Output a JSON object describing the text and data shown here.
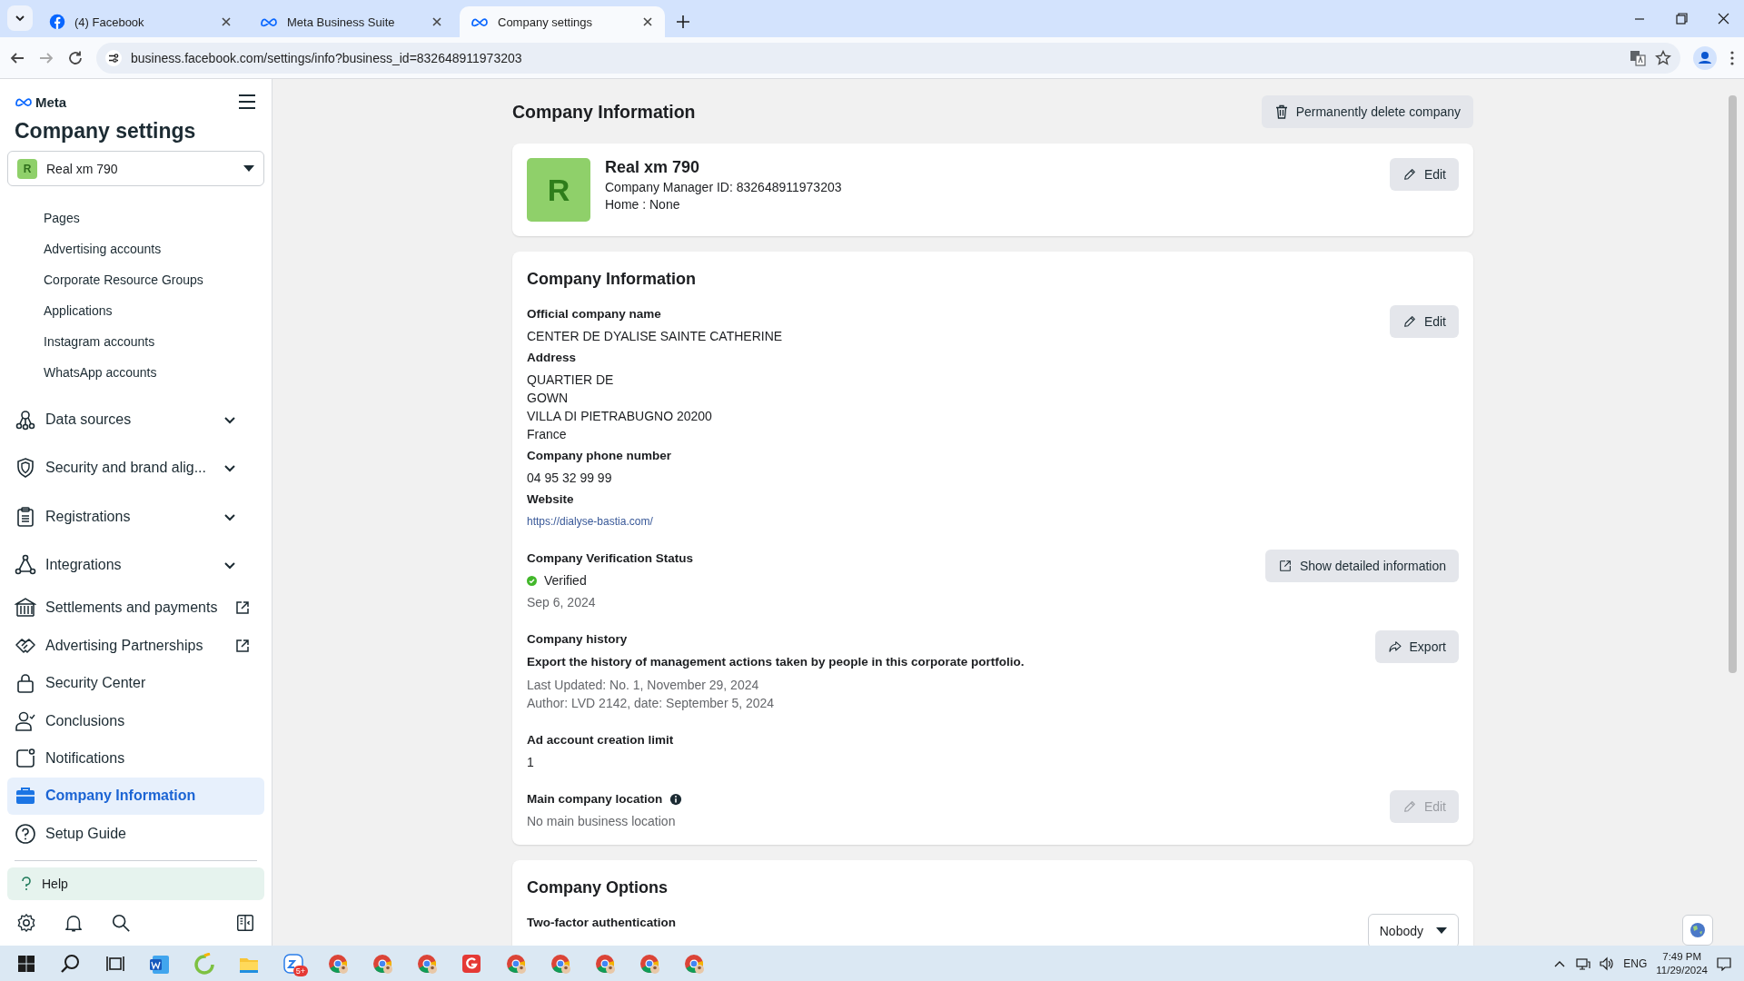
{
  "browser": {
    "tabs": [
      {
        "title": "(4) Facebook",
        "selected": false
      },
      {
        "title": "Meta Business Suite",
        "selected": false
      },
      {
        "title": "Company settings",
        "selected": true
      }
    ],
    "url": "business.facebook.com/settings/info?business_id=832648911973203"
  },
  "sidebar": {
    "brand": "Meta",
    "title": "Company settings",
    "account": {
      "initial": "R",
      "name": "Real xm 790"
    },
    "sub_items": [
      "Pages",
      "Advertising accounts",
      "Corporate Resource Groups",
      "Applications",
      "Instagram accounts",
      "WhatsApp accounts"
    ],
    "items": [
      {
        "label": "Data sources",
        "kind": "expandable",
        "selected": false
      },
      {
        "label": "Security and brand alig...",
        "kind": "expandable",
        "selected": false
      },
      {
        "label": "Registrations",
        "kind": "expandable",
        "selected": false
      },
      {
        "label": "Integrations",
        "kind": "expandable",
        "selected": false
      },
      {
        "label": "Settlements and payments",
        "kind": "external",
        "selected": false
      },
      {
        "label": "Advertising Partnerships",
        "kind": "external",
        "selected": false
      },
      {
        "label": "Security Center",
        "kind": "plain",
        "selected": false
      },
      {
        "label": "Conclusions",
        "kind": "plain",
        "selected": false
      },
      {
        "label": "Notifications",
        "kind": "plain",
        "selected": false
      },
      {
        "label": "Company Information",
        "kind": "plain",
        "selected": true
      },
      {
        "label": "Setup Guide",
        "kind": "plain",
        "selected": false
      }
    ],
    "help": "Help"
  },
  "main": {
    "heading": "Company Information",
    "delete_button": "Permanently delete company",
    "profile": {
      "initial": "R",
      "name": "Real xm 790",
      "manager_id": "Company Manager ID: 832648911973203",
      "home": "Home : None",
      "button": {
        "label": "Edit",
        "kind": "edit",
        "disabled": false
      }
    },
    "info_card": {
      "title": "Company Information",
      "groups": [
        {
          "button": {
            "label": "Edit",
            "kind": "edit",
            "disabled": false
          },
          "fields": [
            {
              "kind": "text",
              "label": "Official company name",
              "lines": [
                "CENTER DE DYALISE SAINTE CATHERINE"
              ]
            },
            {
              "kind": "text",
              "label": "Address",
              "lines": [
                "QUARTIER DE",
                "GOWN",
                "VILLA DI PIETRABUGNO 20200",
                "France"
              ]
            },
            {
              "kind": "text",
              "label": "Company phone number",
              "lines": [
                "04 95 32 99 99"
              ]
            },
            {
              "kind": "link",
              "label": "Website",
              "lines": [
                "https://dialyse-bastia.com/"
              ]
            }
          ]
        },
        {
          "button": {
            "label": "Show detailed information",
            "kind": "details",
            "disabled": false
          },
          "fields": [
            {
              "kind": "status",
              "label": "Company Verification Status",
              "status": "Verified",
              "verified": true,
              "lines": [
                "Sep 6, 2024"
              ]
            }
          ]
        },
        {
          "button": {
            "label": "Export",
            "kind": "export",
            "disabled": false
          },
          "fields": [
            {
              "kind": "history",
              "label": "Company history",
              "description": "Export the history of management actions taken by people in this corporate portfolio.",
              "lines": [
                "Last Updated: No. 1, November 29, 2024",
                "Author: LVD 2142, date: September 5, 2024"
              ]
            }
          ]
        },
        {
          "fields": [
            {
              "kind": "text",
              "label": "Ad account creation limit",
              "lines": [
                "1"
              ]
            }
          ]
        },
        {
          "button": {
            "label": "Edit",
            "kind": "edit",
            "disabled": true
          },
          "fields": [
            {
              "kind": "muted",
              "label": "Main company location",
              "info": true,
              "lines": [
                "No main business location"
              ]
            }
          ]
        }
      ]
    },
    "options_card": {
      "title": "Company Options",
      "field": "Two-factor authentication",
      "dropdown": "Nobody"
    }
  },
  "taskbar": {
    "badge": "5+",
    "language": "ENG",
    "time": "7:49 PM",
    "date": "11/29/2024"
  }
}
